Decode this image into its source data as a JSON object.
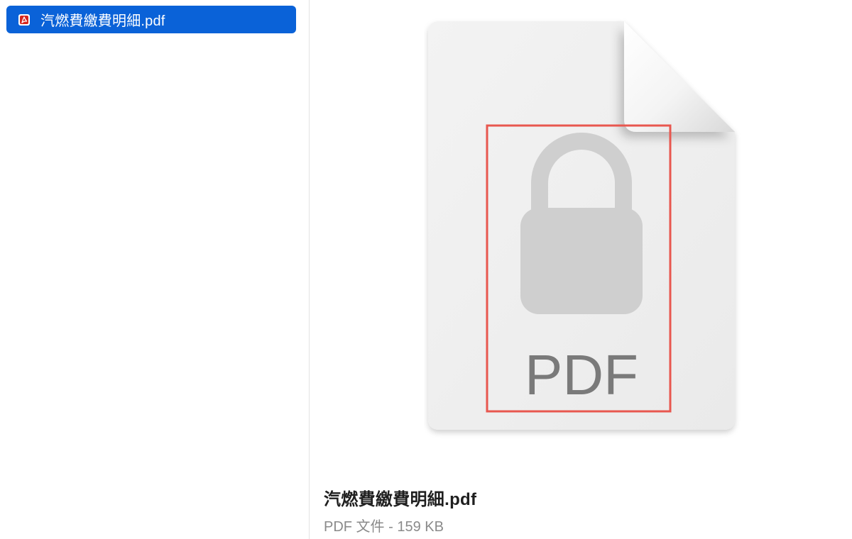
{
  "file_list": {
    "selected_item": {
      "name": "汽燃費繳費明細.pdf",
      "icon": "pdf-file-icon"
    }
  },
  "preview": {
    "icon": "locked-pdf-document-icon",
    "icon_label": "PDF",
    "file_name": "汽燃費繳費明細.pdf",
    "file_info": "PDF 文件 - 159 KB",
    "highlight_color": "#e8574f"
  },
  "colors": {
    "selection": "#0a62d8",
    "pdf_badge": "#d7261e",
    "lock": "#cfcfcf",
    "pdf_text": "#7a7a7a"
  }
}
